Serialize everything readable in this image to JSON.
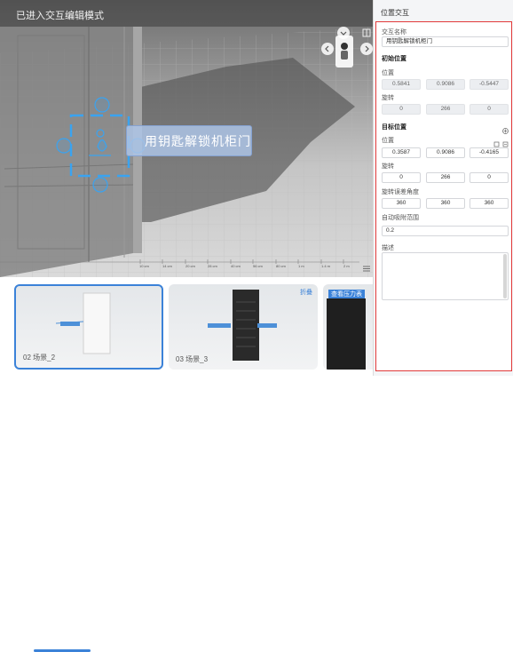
{
  "viewport": {
    "mode_title": "已进入交互编辑模式",
    "scene_label": "用钥匙解锁机柜门",
    "ruler_labels": [
      "10 cm",
      "14 cm",
      "20 cm",
      "28 cm",
      "40 cm",
      "56 cm",
      "80 cm",
      "1 m",
      "1.4 m",
      "2 m",
      "2.8 m",
      "4 m"
    ],
    "icons": [
      "layout-icon",
      "compass-head-icon",
      "arrow-up-icon",
      "arrow-left-icon",
      "arrow-right-icon",
      "grid-icon"
    ]
  },
  "thumbnails": [
    {
      "caption": "02  场景_2",
      "selected": true
    },
    {
      "caption": "03  场景_3",
      "tag": "折叠",
      "selected": false
    },
    {
      "label": "查看压力表",
      "selected": false
    }
  ],
  "panel": {
    "title": "位置交互",
    "interaction_name_label": "交互名称",
    "interaction_name_value": "用钥匙解锁机柜门",
    "initial_section": "初始位置",
    "initial_position_label": "位置",
    "initial_position": [
      "0.5841",
      "0.9086",
      "-0.5447"
    ],
    "initial_rotation_label": "旋转",
    "initial_rotation": [
      "0",
      "266",
      "0"
    ],
    "target_section": "目标位置",
    "target_position_label": "位置",
    "target_position": [
      "0.3587",
      "0.9086",
      "-0.4165"
    ],
    "target_rotation_label": "旋转",
    "target_rotation": [
      "0",
      "266",
      "0"
    ],
    "rotation_error_label": "旋转误差角度",
    "rotation_error": [
      "360",
      "360",
      "360"
    ],
    "snap_range_label": "自动吸附范围",
    "snap_range_value": "0.2",
    "description_label": "描述",
    "description_value": ""
  },
  "colors": {
    "accent": "#3b82d8",
    "highlight_border": "#e23a3a"
  }
}
